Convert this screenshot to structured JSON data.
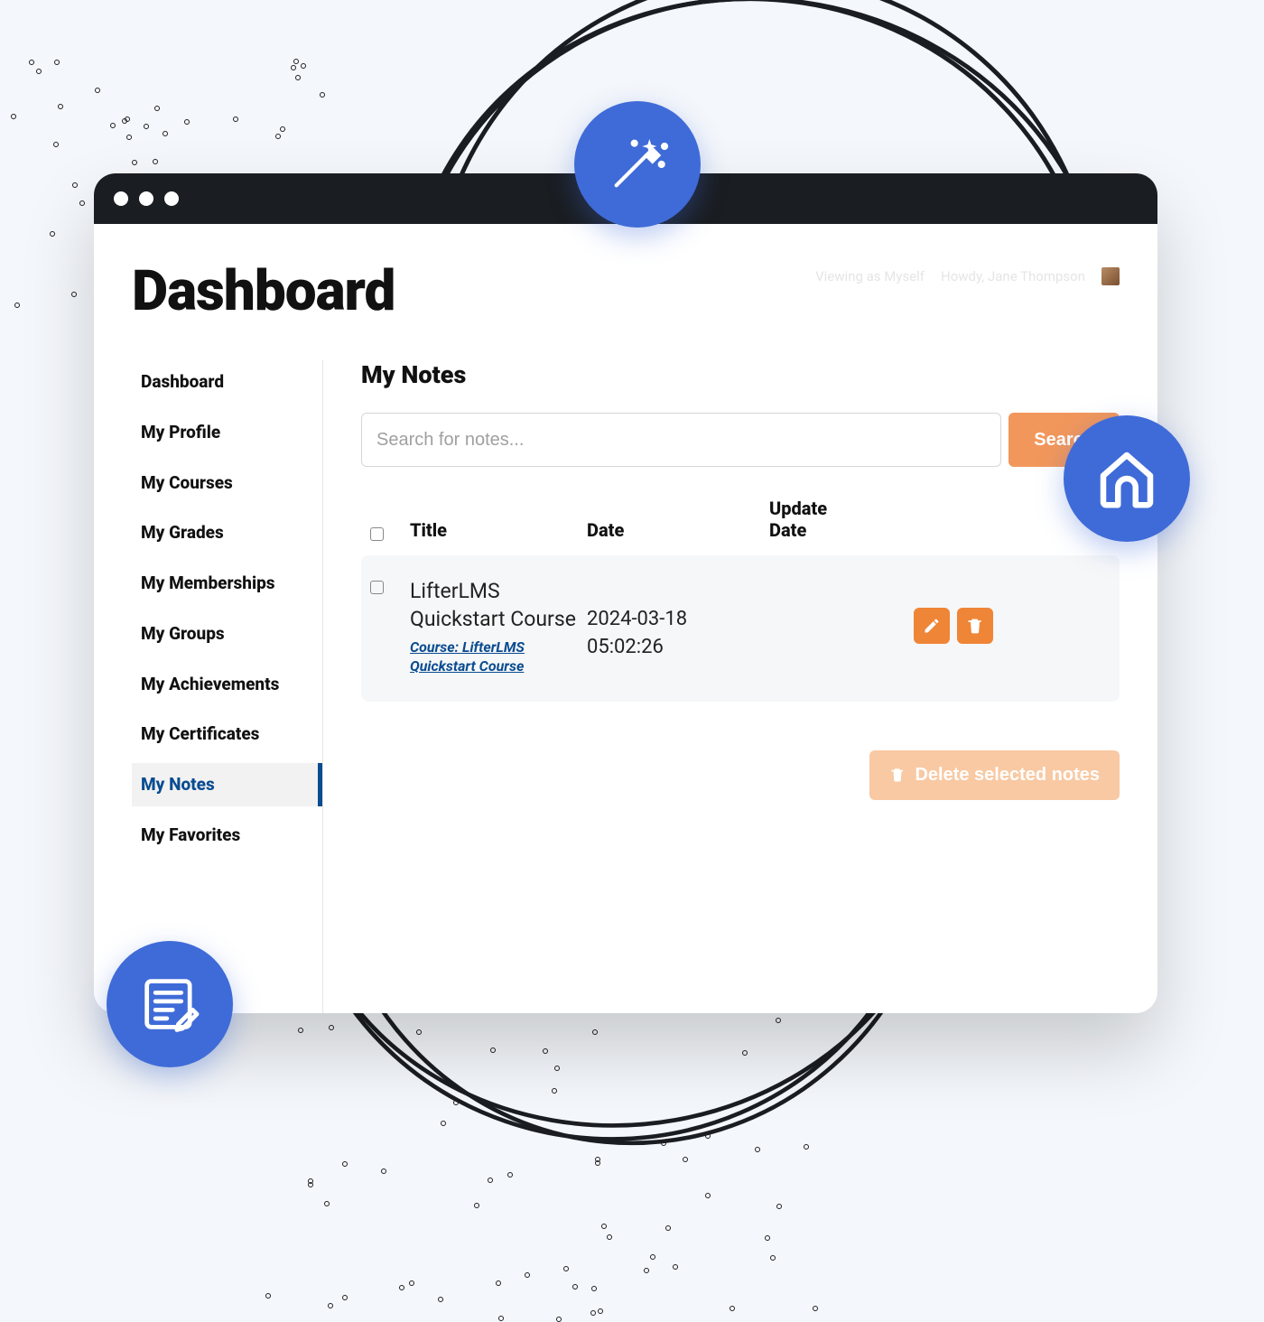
{
  "page_title": "Dashboard",
  "user_meta": {
    "viewing_as": "Viewing as Myself",
    "howdy": "Howdy, Jane Thompson"
  },
  "sidebar": {
    "items": [
      {
        "label": "Dashboard"
      },
      {
        "label": "My Profile"
      },
      {
        "label": "My Courses"
      },
      {
        "label": "My Grades"
      },
      {
        "label": "My Memberships"
      },
      {
        "label": "My Groups"
      },
      {
        "label": "My Achievements"
      },
      {
        "label": "My Certificates"
      },
      {
        "label": "My Notes"
      },
      {
        "label": "My Favorites"
      }
    ],
    "active_index": 8
  },
  "section_title": "My Notes",
  "search": {
    "placeholder": "Search for notes...",
    "button": "Search"
  },
  "table": {
    "headers": {
      "title": "Title",
      "date": "Date",
      "update": "Update Date"
    },
    "rows": [
      {
        "title": "LifterLMS Quickstart Course",
        "link_label": "Course: LifterLMS Quickstart Course",
        "date": "2024-03-18 05:02:26",
        "update_date": ""
      }
    ]
  },
  "delete_button": "Delete selected notes",
  "colors": {
    "accent_orange": "#ef8536",
    "accent_orange_light": "#f2975b",
    "accent_orange_pale": "#f8c9a3",
    "link_blue": "#0a4c90",
    "badge_blue": "#3f6bd8",
    "blob_yellow": "#f3bb0e"
  }
}
